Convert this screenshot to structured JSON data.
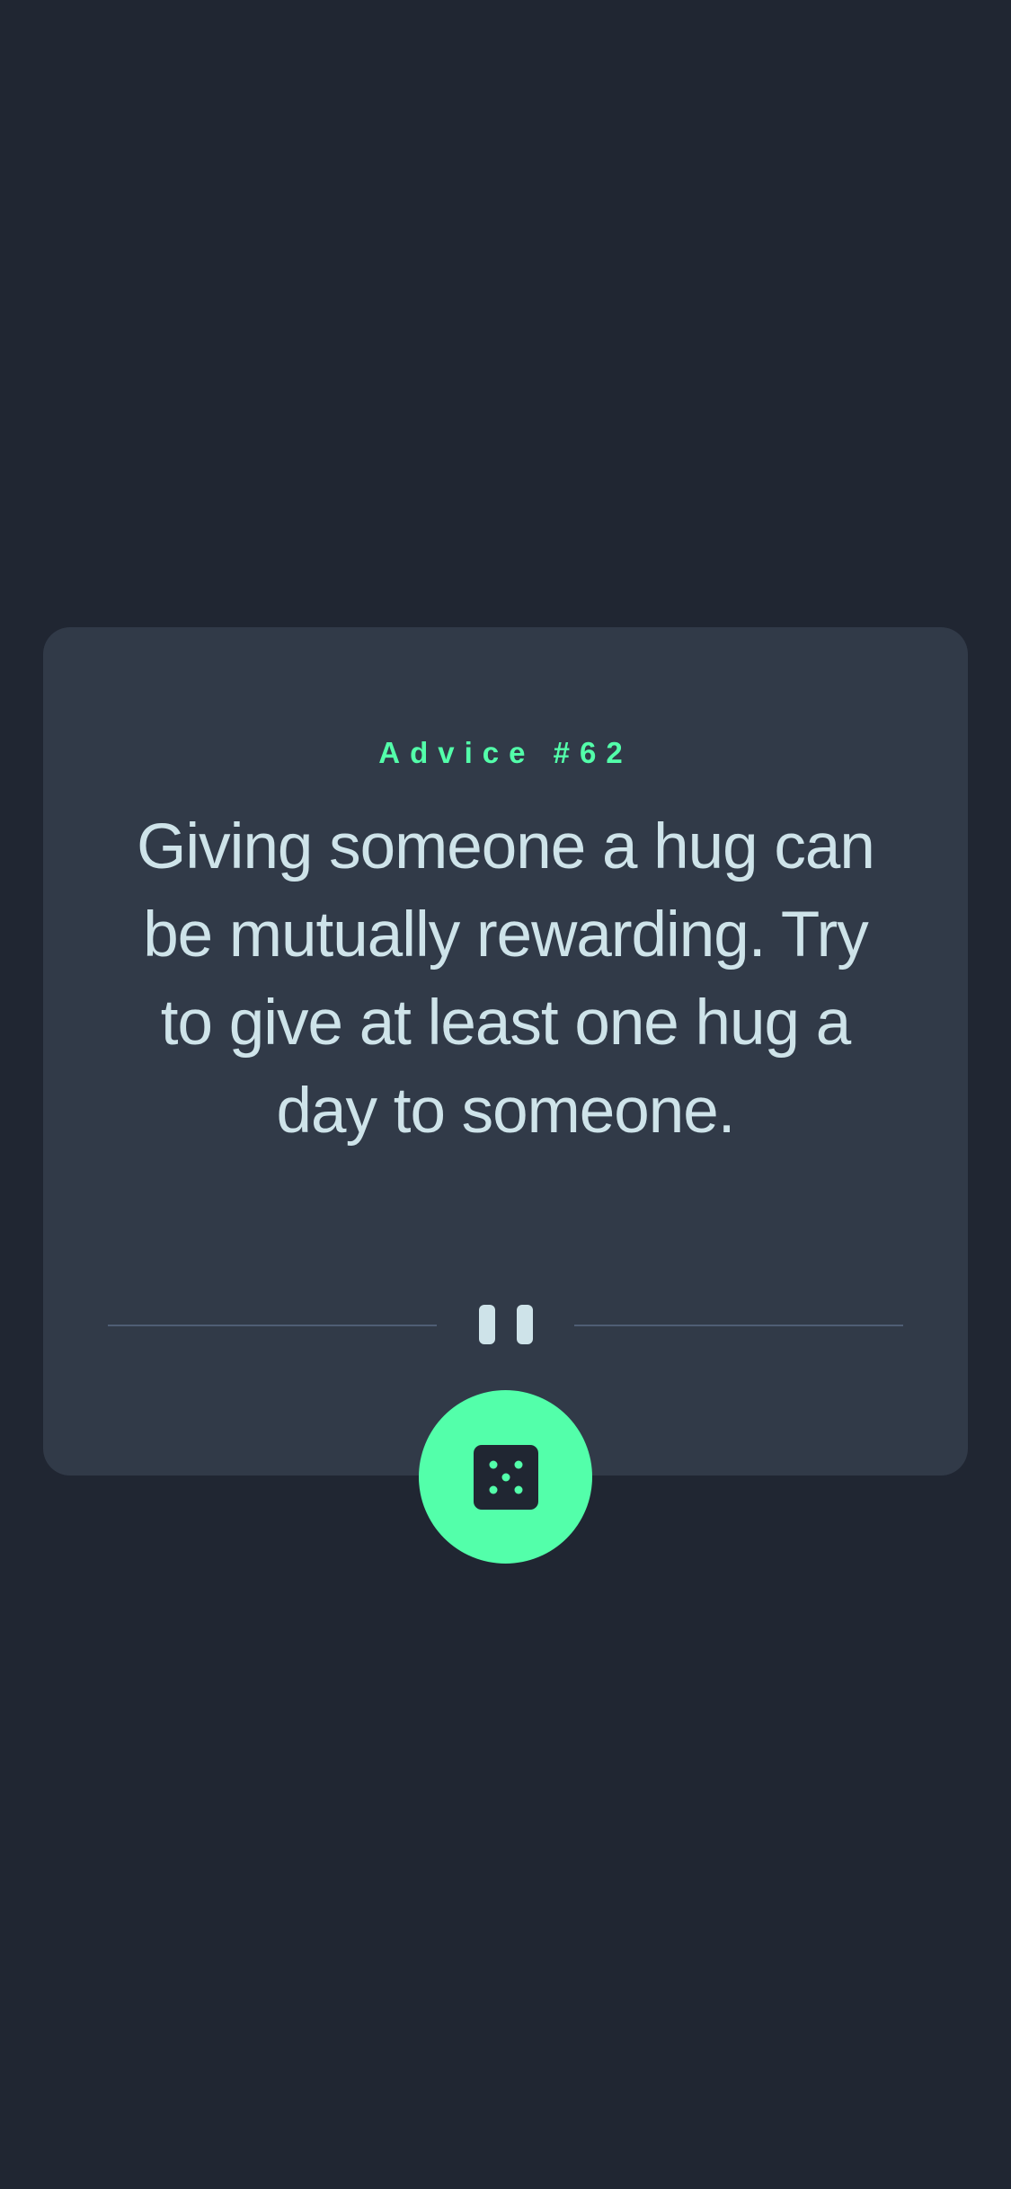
{
  "advice": {
    "label": "Advice #62",
    "text": "Giving someone a hug can be mutually rewarding. Try to give at least one hug a day to someone."
  },
  "divider": {
    "icon": "pause-icon"
  },
  "generate_button": {
    "icon": "dice-icon"
  },
  "colors": {
    "background": "#202632",
    "card": "#313A48",
    "accent": "#53FFAA",
    "text": "#CEE3E9",
    "divider": "#4F5D74"
  }
}
